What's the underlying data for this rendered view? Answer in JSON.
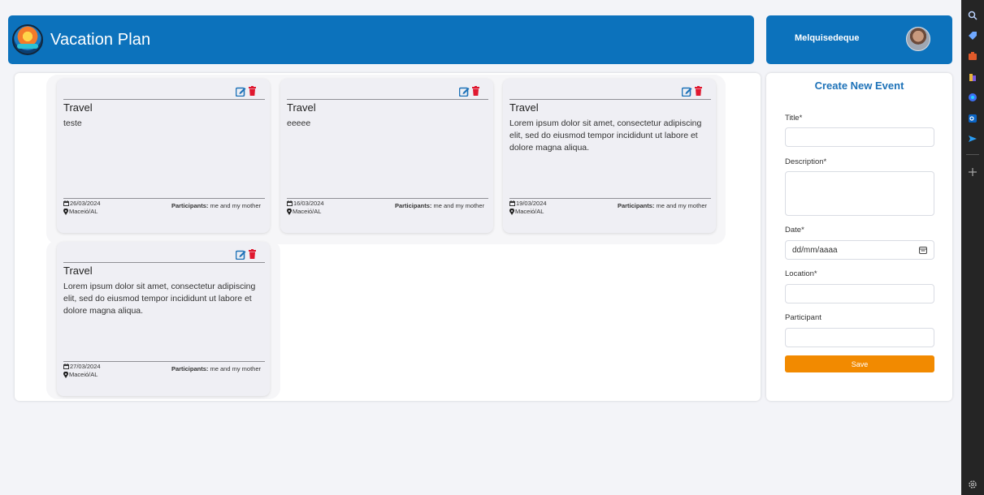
{
  "header": {
    "app_title": "Vacation Plan",
    "username": "Melquisedeque"
  },
  "events": [
    {
      "title": "Travel",
      "description": "teste",
      "date": "26/03/2024",
      "location": "Maceió/AL",
      "participants_label": "Participants:",
      "participants": "me and my mother"
    },
    {
      "title": "Travel",
      "description": "eeeee",
      "date": "16/03/2024",
      "location": "Maceió/AL",
      "participants_label": "Participants:",
      "participants": "me and my mother"
    },
    {
      "title": "Travel",
      "description": "Lorem ipsum dolor sit amet, consectetur adipiscing elit, sed do eiusmod tempor incididunt ut labore et dolore magna aliqua.",
      "date": "19/03/2024",
      "location": "Maceió/AL",
      "participants_label": "Participants:",
      "participants": "me and my mother"
    },
    {
      "title": "Travel",
      "description": "Lorem ipsum dolor sit amet, consectetur adipiscing elit, sed do eiusmod tempor incididunt ut labore et dolore magna aliqua.",
      "date": "27/03/2024",
      "location": "Maceió/AL",
      "participants_label": "Participants:",
      "participants": "me and my mother"
    }
  ],
  "form": {
    "title": "Create New Event",
    "title_label": "Title*",
    "description_label": "Description*",
    "date_label": "Date*",
    "date_placeholder": "dd/mm/aaaa",
    "location_label": "Location*",
    "participant_label": "Participant",
    "save_label": "Save"
  },
  "colors": {
    "primary": "#0c72bc",
    "danger": "#e0182f",
    "edit": "#1d72b8",
    "save": "#f28a00"
  },
  "sidebar_icons": [
    "search-icon",
    "tag-icon",
    "briefcase-icon",
    "chess-icon",
    "copilot-icon",
    "outlook-icon",
    "send-icon",
    "plus-icon",
    "settings-icon"
  ]
}
